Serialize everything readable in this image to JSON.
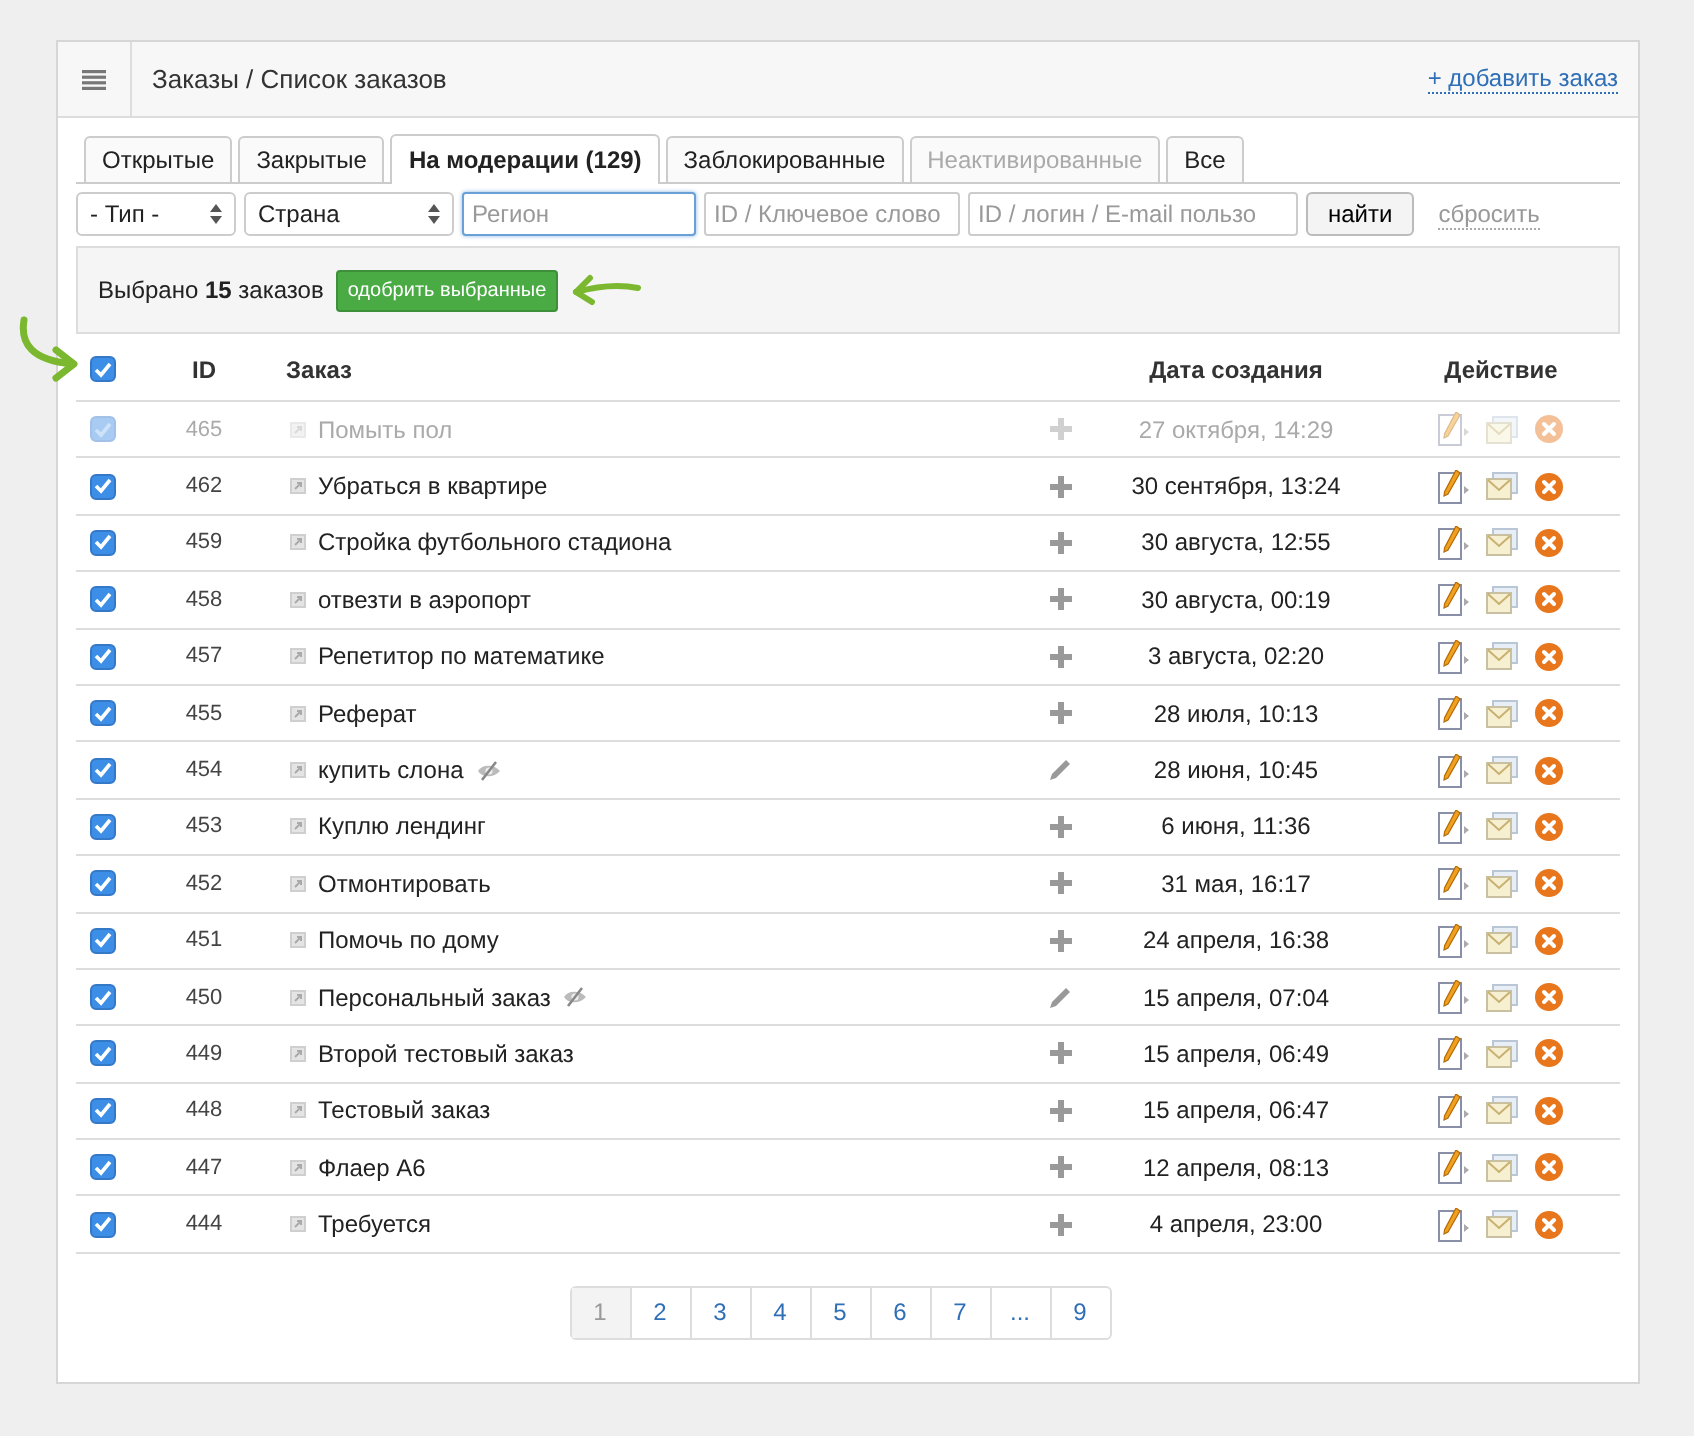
{
  "header": {
    "title": "Заказы / Список заказов",
    "add_link": "+ добавить заказ"
  },
  "tabs": [
    {
      "label": "Открытые",
      "selected": false,
      "disabled": false
    },
    {
      "label": "Закрытые",
      "selected": false,
      "disabled": false
    },
    {
      "label": "На модерации (129)",
      "selected": true,
      "disabled": false
    },
    {
      "label": "Заблокированные",
      "selected": false,
      "disabled": false
    },
    {
      "label": "Неактивированные",
      "selected": false,
      "disabled": true
    },
    {
      "label": "Все",
      "selected": false,
      "disabled": false
    }
  ],
  "filters": [
    {
      "kind": "select",
      "value": "- Тип -"
    },
    {
      "kind": "select",
      "value": "Страна"
    },
    {
      "kind": "input",
      "placeholder": "Регион",
      "focused": true
    },
    {
      "kind": "input",
      "placeholder": "ID / Ключевое слово",
      "focused": false
    },
    {
      "kind": "input",
      "placeholder": "ID / логин / E-mail пользо",
      "focused": false
    }
  ],
  "search_button": "найти",
  "reset_link": "сбросить",
  "selection": {
    "prefix": "Выбрано",
    "count": "15",
    "suffix": "заказов",
    "approve_button": "одобрить выбранные"
  },
  "table": {
    "select_all_checked": true,
    "columns": [
      "ID",
      "Заказ",
      "Дата создания",
      "Действие"
    ],
    "rows": [
      {
        "id": "465",
        "title": "Помыть пол",
        "date": "27 октября, 14:29",
        "checked": true,
        "disabled": true,
        "kind": "add",
        "hidden": false
      },
      {
        "id": "462",
        "title": "Убраться в квартире",
        "date": "30 сентября, 13:24",
        "checked": true,
        "disabled": false,
        "kind": "add",
        "hidden": false
      },
      {
        "id": "459",
        "title": "Стройка футбольного стадиона",
        "date": "30 августа, 12:55",
        "checked": true,
        "disabled": false,
        "kind": "add",
        "hidden": false
      },
      {
        "id": "458",
        "title": "отвезти в аэропорт",
        "date": "30 августа, 00:19",
        "checked": true,
        "disabled": false,
        "kind": "add",
        "hidden": false
      },
      {
        "id": "457",
        "title": "Репетитор по математике",
        "date": "3 августа, 02:20",
        "checked": true,
        "disabled": false,
        "kind": "add",
        "hidden": false
      },
      {
        "id": "455",
        "title": "Реферат",
        "date": "28 июля, 10:13",
        "checked": true,
        "disabled": false,
        "kind": "add",
        "hidden": false
      },
      {
        "id": "454",
        "title": "купить слона",
        "date": "28 июня, 10:45",
        "checked": true,
        "disabled": false,
        "kind": "edit",
        "hidden": true
      },
      {
        "id": "453",
        "title": "Куплю лендинг",
        "date": "6 июня, 11:36",
        "checked": true,
        "disabled": false,
        "kind": "add",
        "hidden": false
      },
      {
        "id": "452",
        "title": "Отмонтировать",
        "date": "31 мая, 16:17",
        "checked": true,
        "disabled": false,
        "kind": "add",
        "hidden": false
      },
      {
        "id": "451",
        "title": "Помочь по дому",
        "date": "24 апреля, 16:38",
        "checked": true,
        "disabled": false,
        "kind": "add",
        "hidden": false
      },
      {
        "id": "450",
        "title": "Персональный заказ",
        "date": "15 апреля, 07:04",
        "checked": true,
        "disabled": false,
        "kind": "edit",
        "hidden": true
      },
      {
        "id": "449",
        "title": "Второй тестовый заказ",
        "date": "15 апреля, 06:49",
        "checked": true,
        "disabled": false,
        "kind": "add",
        "hidden": false
      },
      {
        "id": "448",
        "title": "Тестовый заказ",
        "date": "15 апреля, 06:47",
        "checked": true,
        "disabled": false,
        "kind": "add",
        "hidden": false
      },
      {
        "id": "447",
        "title": "Флаер А6",
        "date": "12 апреля, 08:13",
        "checked": true,
        "disabled": false,
        "kind": "add",
        "hidden": false
      },
      {
        "id": "444",
        "title": "Требуется",
        "date": "4 апреля, 23:00",
        "checked": true,
        "disabled": false,
        "kind": "add",
        "hidden": false
      }
    ]
  },
  "pagination": [
    {
      "label": "1",
      "selected": true
    },
    {
      "label": "2",
      "selected": false
    },
    {
      "label": "3",
      "selected": false
    },
    {
      "label": "4",
      "selected": false
    },
    {
      "label": "5",
      "selected": false
    },
    {
      "label": "6",
      "selected": false
    },
    {
      "label": "7",
      "selected": false
    },
    {
      "label": "...",
      "selected": false
    },
    {
      "label": "9",
      "selected": false
    }
  ]
}
